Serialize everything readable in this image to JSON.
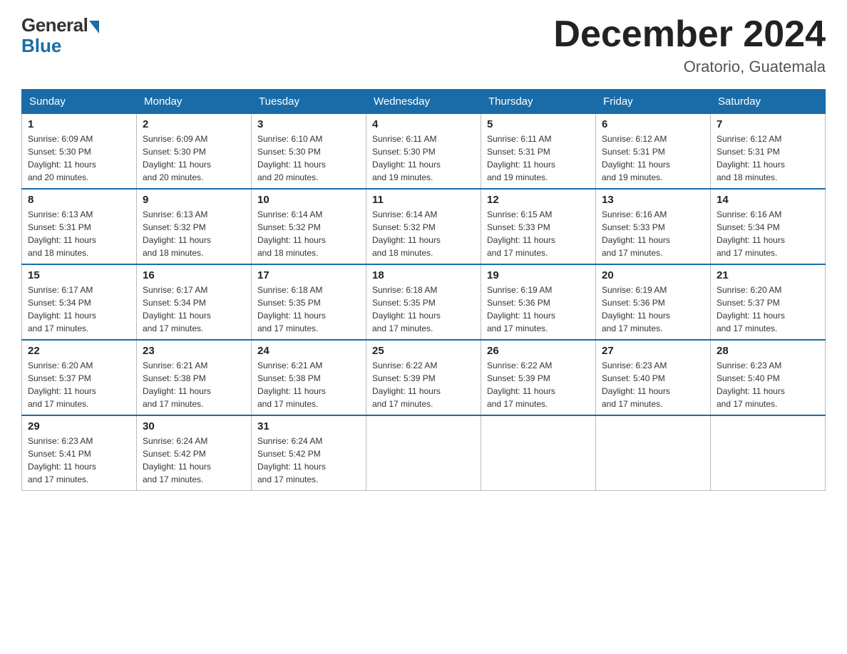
{
  "logo": {
    "general": "General",
    "blue": "Blue"
  },
  "title": "December 2024",
  "location": "Oratorio, Guatemala",
  "days_of_week": [
    "Sunday",
    "Monday",
    "Tuesday",
    "Wednesday",
    "Thursday",
    "Friday",
    "Saturday"
  ],
  "weeks": [
    [
      {
        "day": "1",
        "sunrise": "6:09 AM",
        "sunset": "5:30 PM",
        "daylight": "11 hours and 20 minutes."
      },
      {
        "day": "2",
        "sunrise": "6:09 AM",
        "sunset": "5:30 PM",
        "daylight": "11 hours and 20 minutes."
      },
      {
        "day": "3",
        "sunrise": "6:10 AM",
        "sunset": "5:30 PM",
        "daylight": "11 hours and 20 minutes."
      },
      {
        "day": "4",
        "sunrise": "6:11 AM",
        "sunset": "5:30 PM",
        "daylight": "11 hours and 19 minutes."
      },
      {
        "day": "5",
        "sunrise": "6:11 AM",
        "sunset": "5:31 PM",
        "daylight": "11 hours and 19 minutes."
      },
      {
        "day": "6",
        "sunrise": "6:12 AM",
        "sunset": "5:31 PM",
        "daylight": "11 hours and 19 minutes."
      },
      {
        "day": "7",
        "sunrise": "6:12 AM",
        "sunset": "5:31 PM",
        "daylight": "11 hours and 18 minutes."
      }
    ],
    [
      {
        "day": "8",
        "sunrise": "6:13 AM",
        "sunset": "5:31 PM",
        "daylight": "11 hours and 18 minutes."
      },
      {
        "day": "9",
        "sunrise": "6:13 AM",
        "sunset": "5:32 PM",
        "daylight": "11 hours and 18 minutes."
      },
      {
        "day": "10",
        "sunrise": "6:14 AM",
        "sunset": "5:32 PM",
        "daylight": "11 hours and 18 minutes."
      },
      {
        "day": "11",
        "sunrise": "6:14 AM",
        "sunset": "5:32 PM",
        "daylight": "11 hours and 18 minutes."
      },
      {
        "day": "12",
        "sunrise": "6:15 AM",
        "sunset": "5:33 PM",
        "daylight": "11 hours and 17 minutes."
      },
      {
        "day": "13",
        "sunrise": "6:16 AM",
        "sunset": "5:33 PM",
        "daylight": "11 hours and 17 minutes."
      },
      {
        "day": "14",
        "sunrise": "6:16 AM",
        "sunset": "5:34 PM",
        "daylight": "11 hours and 17 minutes."
      }
    ],
    [
      {
        "day": "15",
        "sunrise": "6:17 AM",
        "sunset": "5:34 PM",
        "daylight": "11 hours and 17 minutes."
      },
      {
        "day": "16",
        "sunrise": "6:17 AM",
        "sunset": "5:34 PM",
        "daylight": "11 hours and 17 minutes."
      },
      {
        "day": "17",
        "sunrise": "6:18 AM",
        "sunset": "5:35 PM",
        "daylight": "11 hours and 17 minutes."
      },
      {
        "day": "18",
        "sunrise": "6:18 AM",
        "sunset": "5:35 PM",
        "daylight": "11 hours and 17 minutes."
      },
      {
        "day": "19",
        "sunrise": "6:19 AM",
        "sunset": "5:36 PM",
        "daylight": "11 hours and 17 minutes."
      },
      {
        "day": "20",
        "sunrise": "6:19 AM",
        "sunset": "5:36 PM",
        "daylight": "11 hours and 17 minutes."
      },
      {
        "day": "21",
        "sunrise": "6:20 AM",
        "sunset": "5:37 PM",
        "daylight": "11 hours and 17 minutes."
      }
    ],
    [
      {
        "day": "22",
        "sunrise": "6:20 AM",
        "sunset": "5:37 PM",
        "daylight": "11 hours and 17 minutes."
      },
      {
        "day": "23",
        "sunrise": "6:21 AM",
        "sunset": "5:38 PM",
        "daylight": "11 hours and 17 minutes."
      },
      {
        "day": "24",
        "sunrise": "6:21 AM",
        "sunset": "5:38 PM",
        "daylight": "11 hours and 17 minutes."
      },
      {
        "day": "25",
        "sunrise": "6:22 AM",
        "sunset": "5:39 PM",
        "daylight": "11 hours and 17 minutes."
      },
      {
        "day": "26",
        "sunrise": "6:22 AM",
        "sunset": "5:39 PM",
        "daylight": "11 hours and 17 minutes."
      },
      {
        "day": "27",
        "sunrise": "6:23 AM",
        "sunset": "5:40 PM",
        "daylight": "11 hours and 17 minutes."
      },
      {
        "day": "28",
        "sunrise": "6:23 AM",
        "sunset": "5:40 PM",
        "daylight": "11 hours and 17 minutes."
      }
    ],
    [
      {
        "day": "29",
        "sunrise": "6:23 AM",
        "sunset": "5:41 PM",
        "daylight": "11 hours and 17 minutes."
      },
      {
        "day": "30",
        "sunrise": "6:24 AM",
        "sunset": "5:42 PM",
        "daylight": "11 hours and 17 minutes."
      },
      {
        "day": "31",
        "sunrise": "6:24 AM",
        "sunset": "5:42 PM",
        "daylight": "11 hours and 17 minutes."
      },
      null,
      null,
      null,
      null
    ]
  ],
  "labels": {
    "sunrise": "Sunrise:",
    "sunset": "Sunset:",
    "daylight": "Daylight:"
  }
}
